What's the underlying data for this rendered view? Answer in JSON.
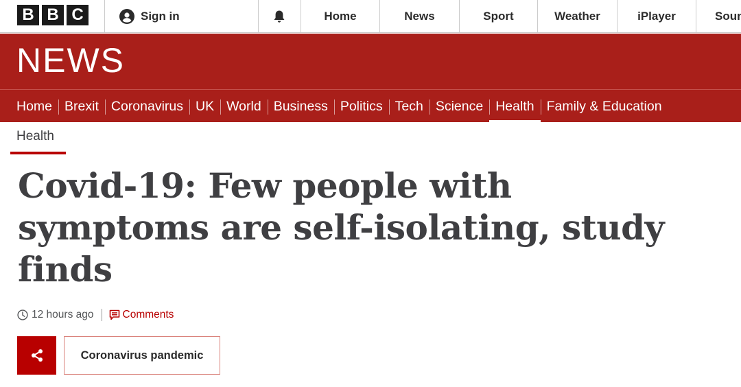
{
  "top_bar": {
    "logo_letters": [
      "B",
      "B",
      "C"
    ],
    "sign_in_label": "Sign in",
    "sign_in_icon": "user-icon",
    "notifications_icon": "bell-icon",
    "nav": [
      "Home",
      "News",
      "Sport",
      "Weather",
      "iPlayer",
      "Soun"
    ]
  },
  "banner": {
    "wordmark": "NEWS",
    "color": "#a91f1a"
  },
  "section_nav": {
    "items": [
      "Home",
      "Brexit",
      "Coronavirus",
      "UK",
      "World",
      "Business",
      "Politics",
      "Tech",
      "Science",
      "Health",
      "Family & Education"
    ],
    "active": "Health"
  },
  "article": {
    "section": "Health",
    "headline": "Covid-19: Few people with symptoms are self-isolating, study finds",
    "timestamp": "12 hours ago",
    "timestamp_icon": "clock-icon",
    "comments_label": "Comments",
    "comments_icon": "comments-icon",
    "share_icon": "share-icon",
    "tag": "Coronavirus pandemic",
    "accent": "#b80000"
  }
}
